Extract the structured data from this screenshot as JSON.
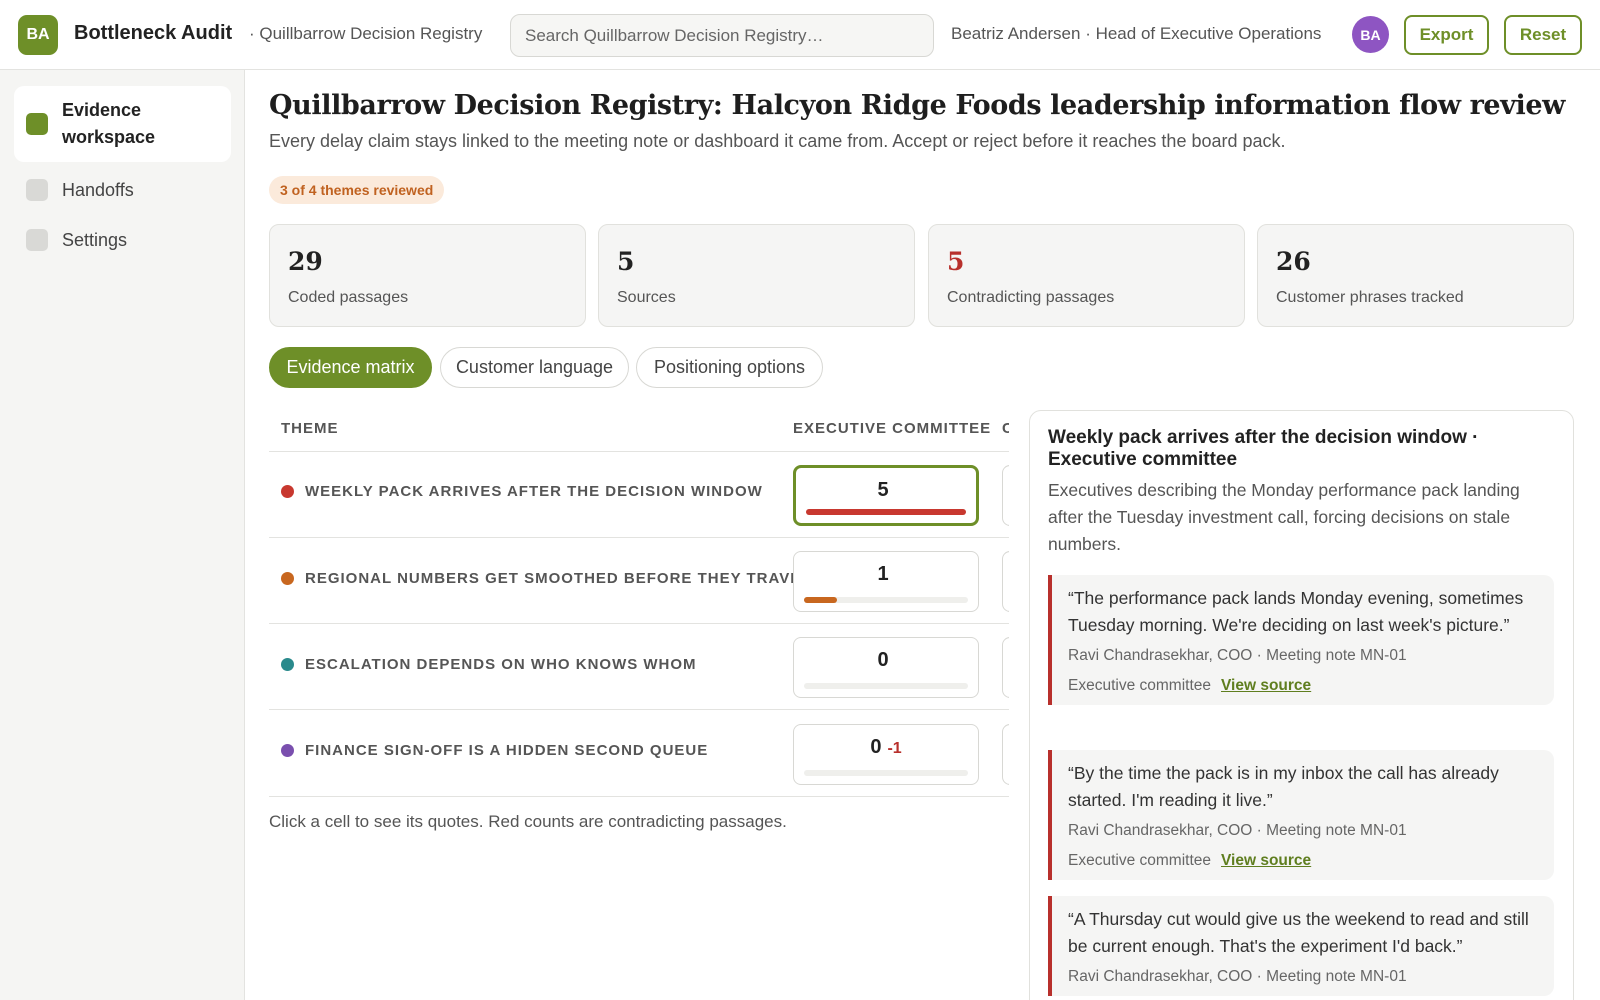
{
  "header": {
    "logo_initials": "BA",
    "app_title": "Bottleneck Audit",
    "breadcrumb": "· Quillbarrow Decision Registry",
    "search_placeholder": "Search Quillbarrow Decision Registry…",
    "user_label": "Beatriz Andersen · Head of Executive Operations",
    "avatar_initials": "BA",
    "export_label": "Export",
    "reset_label": "Reset"
  },
  "sidebar": {
    "items": [
      {
        "label": "Evidence workspace",
        "active": true
      },
      {
        "label": "Handoffs",
        "active": false
      },
      {
        "label": "Settings",
        "active": false
      }
    ]
  },
  "main": {
    "title": "Quillbarrow Decision Registry: Halcyon Ridge Foods leadership information flow review",
    "subtitle": "Every delay claim stays linked to the meeting note or dashboard it came from. Accept or reject before it reaches the board pack.",
    "progress_badge": "3 of 4 themes reviewed",
    "stats": [
      {
        "value": "29",
        "label": "Coded passages",
        "highlight": false
      },
      {
        "value": "5",
        "label": "Sources",
        "highlight": false
      },
      {
        "value": "5",
        "label": "Contradicting passages",
        "highlight": true
      },
      {
        "value": "26",
        "label": "Customer phrases tracked",
        "highlight": false
      }
    ],
    "tabs": [
      {
        "label": "Evidence matrix",
        "active": true
      },
      {
        "label": "Customer language",
        "active": false
      },
      {
        "label": "Positioning options",
        "active": false
      }
    ]
  },
  "matrix": {
    "columns": [
      "THEME",
      "EXECUTIVE COMMITTEE"
    ],
    "rows": [
      {
        "theme": "WEEKLY PACK ARRIVES AFTER THE DECISION WINDOW",
        "dot_color": "#c8382f",
        "count": "5",
        "contradicting": "",
        "fill_fraction": 1.0,
        "bar_color": "#c8382f",
        "selected": true
      },
      {
        "theme": "REGIONAL NUMBERS GET SMOOTHED BEFORE THEY TRAVEL",
        "dot_color": "#c8671f",
        "count": "1",
        "contradicting": "",
        "fill_fraction": 0.2,
        "bar_color": "#c8671f",
        "selected": false
      },
      {
        "theme": "ESCALATION DEPENDS ON WHO KNOWS WHOM",
        "dot_color": "#2a8a8c",
        "count": "0",
        "contradicting": "",
        "fill_fraction": 0.0,
        "bar_color": "#2a8a8c",
        "selected": false
      },
      {
        "theme": "FINANCE SIGN-OFF IS A HIDDEN SECOND QUEUE",
        "dot_color": "#7a4fae",
        "count": "0",
        "contradicting": "-1",
        "fill_fraction": 0.0,
        "bar_color": "#7a4fae",
        "selected": false
      }
    ],
    "note": "Click a cell to see its quotes. Red counts are contradicting passages."
  },
  "detail": {
    "title": "Weekly pack arrives after the decision window · Executive committee",
    "description": "Executives describing the Monday performance pack landing after the Tuesday investment call, forcing decisions on stale numbers.",
    "quotes": [
      {
        "text": "“The performance pack lands Monday evening, sometimes Tuesday morning. We're deciding on last week's picture.”",
        "attribution": "Ravi Chandrasekhar, COO · Meeting note MN-01",
        "group": "Executive committee",
        "link": "View source"
      },
      {
        "text": "“By the time the pack is in my inbox the call has already started. I'm reading it live.”",
        "attribution": "Ravi Chandrasekhar, COO · Meeting note MN-01",
        "group": "Executive committee",
        "link": "View source"
      },
      {
        "text": "“A Thursday cut would give us the weekend to read and still be current enough. That's the experiment I'd back.”",
        "attribution": "Ravi Chandrasekhar, COO · Meeting note MN-01",
        "group": "",
        "link": ""
      }
    ]
  },
  "colors": {
    "accent": "#6e8f28",
    "contradict": "#b8302c",
    "badge_bg": "#fbeadb",
    "badge_text": "#c06220",
    "avatar": "#8e55c2"
  }
}
